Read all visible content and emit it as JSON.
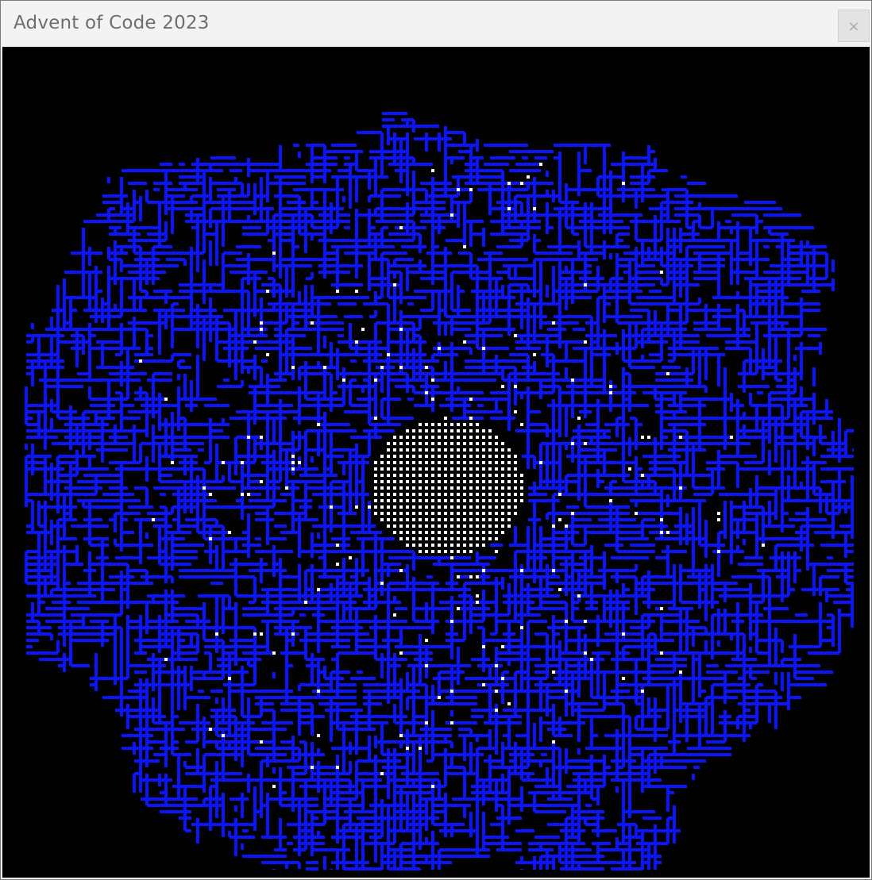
{
  "window": {
    "title": "Advent of Code 2023",
    "close_label": "×"
  },
  "canvas": {
    "background_color": "#000000",
    "pipe_color": "#0a14ff",
    "marker_color": "#ffffff",
    "description_icon": "pipe-maze-visualization"
  }
}
